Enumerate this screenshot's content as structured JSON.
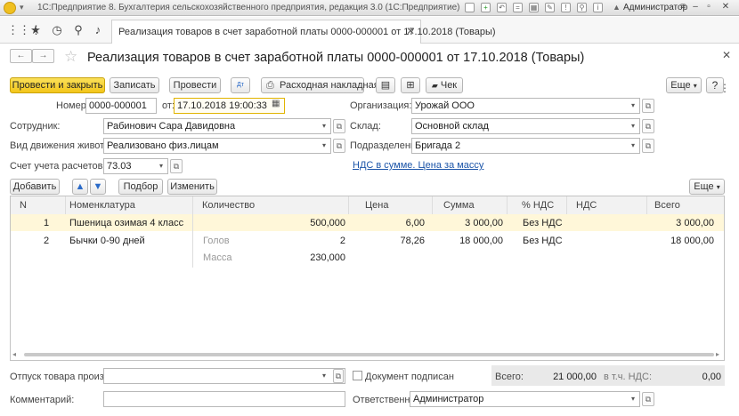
{
  "window": {
    "title": "1С:Предприятие 8. Бухгалтерия сельскохозяйственного предприятия, редакция 3.0  (1С:Предприятие)",
    "user": "Администратор"
  },
  "tab": {
    "label": "Реализация товаров в счет заработной платы 0000-000001 от 17.10.2018 (Товары)"
  },
  "form": {
    "title": "Реализация товаров в счет заработной платы 0000-000001 от 17.10.2018 (Товары)"
  },
  "toolbar": {
    "post_close": "Провести и закрыть",
    "save": "Записать",
    "post": "Провести",
    "invoice": "Расходная накладная",
    "receipt": "Чек",
    "more": "Еще"
  },
  "fields": {
    "number_label": "Номер:",
    "number": "0000-000001",
    "date_label": "от:",
    "date": "17.10.2018 19:00:33",
    "org_label": "Организация:",
    "org": "Урожай ООО",
    "employee_label": "Сотрудник:",
    "employee": "Рабинович Сара Давидовна",
    "warehouse_label": "Склад:",
    "warehouse": "Основной склад",
    "movement_label": "Вид движения животных:",
    "movement": "Реализовано физ.лицам",
    "division_label": "Подразделение:",
    "division": "Бригада 2",
    "account_label": "Счет учета расчетов:",
    "account": "73.03",
    "vat_link": "НДС в сумме. Цена за массу"
  },
  "table_toolbar": {
    "add": "Добавить",
    "pick": "Подбор",
    "change": "Изменить",
    "more": "Еще"
  },
  "table": {
    "headers": [
      "N",
      "Номенклатура",
      "Количество",
      "Цена",
      "Сумма",
      "% НДС",
      "НДС",
      "Всего"
    ],
    "rows": [
      {
        "n": "1",
        "item": "Пшеница озимая 4 класс",
        "qty_label": "",
        "qty": "500,000",
        "price": "6,00",
        "sum": "3 000,00",
        "vat_rate": "Без НДС",
        "vat": "",
        "total": "3 000,00"
      },
      {
        "n": "2",
        "item": "Бычки 0-90 дней",
        "qty_label": "Голов",
        "qty": "2",
        "price": "78,26",
        "sum": "18 000,00",
        "vat_rate": "Без НДС",
        "vat": "",
        "total": "18 000,00",
        "mass_label": "Масса",
        "mass": "230,000"
      }
    ]
  },
  "footer": {
    "released_label": "Отпуск товара произвел:",
    "released": "",
    "signed_label": "Документ подписан",
    "total_label": "Всего:",
    "total": "21 000,00",
    "vat_label": "в т.ч. НДС:",
    "vat": "0,00",
    "comment_label": "Комментарий:",
    "comment": "",
    "responsible_label": "Ответственный:",
    "responsible": "Администратор"
  },
  "colors": {
    "primary": "#f3c61a",
    "link": "#1b54a8",
    "row_highlight": "#fff7d9"
  }
}
